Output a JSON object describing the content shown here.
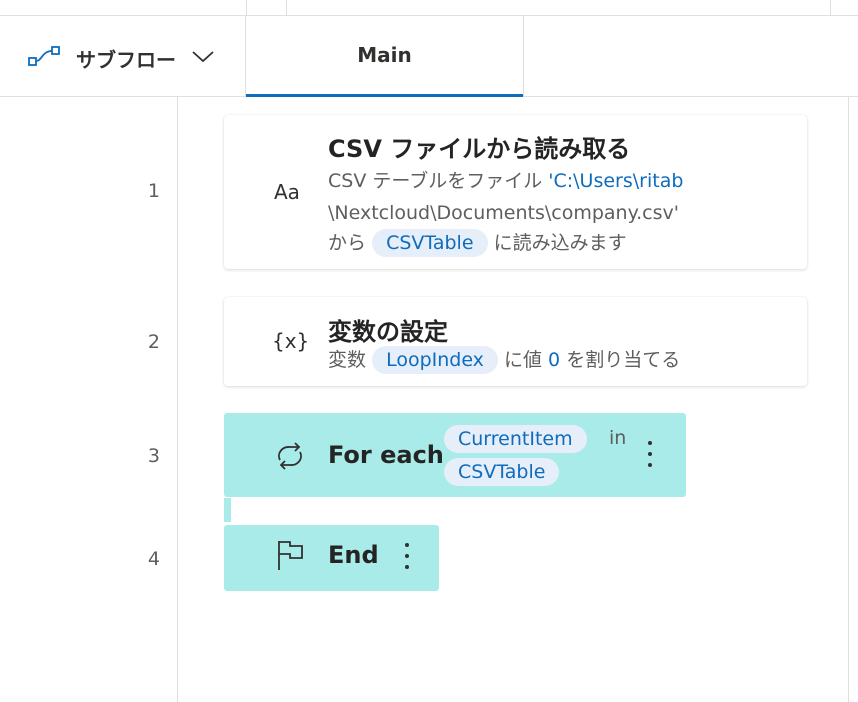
{
  "tabs": {
    "subflow_label": "サブフロー",
    "main_label": "Main"
  },
  "line_numbers": [
    "1",
    "2",
    "3",
    "4"
  ],
  "actions": [
    {
      "icon_text": "Aa",
      "title": "CSV ファイルから読み取る",
      "desc_prefix": "CSV テーブルをファイル ",
      "path_line1": "'C:\\Users\\ritab",
      "path_line2": "\\Nextcloud\\Documents\\company.csv'",
      "from": "から",
      "variable": "CSVTable",
      "suffix": "に読み込みます"
    },
    {
      "icon_text": "{x}",
      "title": "変数の設定",
      "desc_prefix": "変数",
      "variable": "LoopIndex",
      "middle": "に値",
      "value": "0",
      "suffix": "を割り当てる"
    }
  ],
  "loop": {
    "label": "For each",
    "item_var": "CurrentItem",
    "in": "in",
    "collection": "CSVTable",
    "end_label": "End"
  },
  "colors": {
    "accent": "#0f6cbd",
    "loop_bg": "#a9ebe8",
    "pill_bg": "#e5eef9"
  },
  "icons": [
    "subflow-icon",
    "chevron-down-icon",
    "text-icon",
    "variable-icon",
    "loop-icon",
    "flag-icon",
    "more-vertical-icon"
  ]
}
